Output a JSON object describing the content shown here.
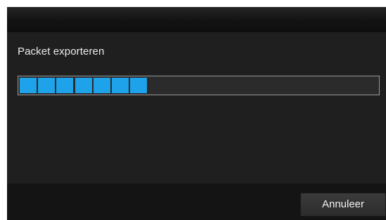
{
  "dialog": {
    "message": "Packet exporteren",
    "progress": {
      "segments_total": 20,
      "segments_filled": 7,
      "fill_color": "#1ea2ea",
      "track_color": "#2b2b2b"
    },
    "cancel_label": "Annuleer"
  }
}
